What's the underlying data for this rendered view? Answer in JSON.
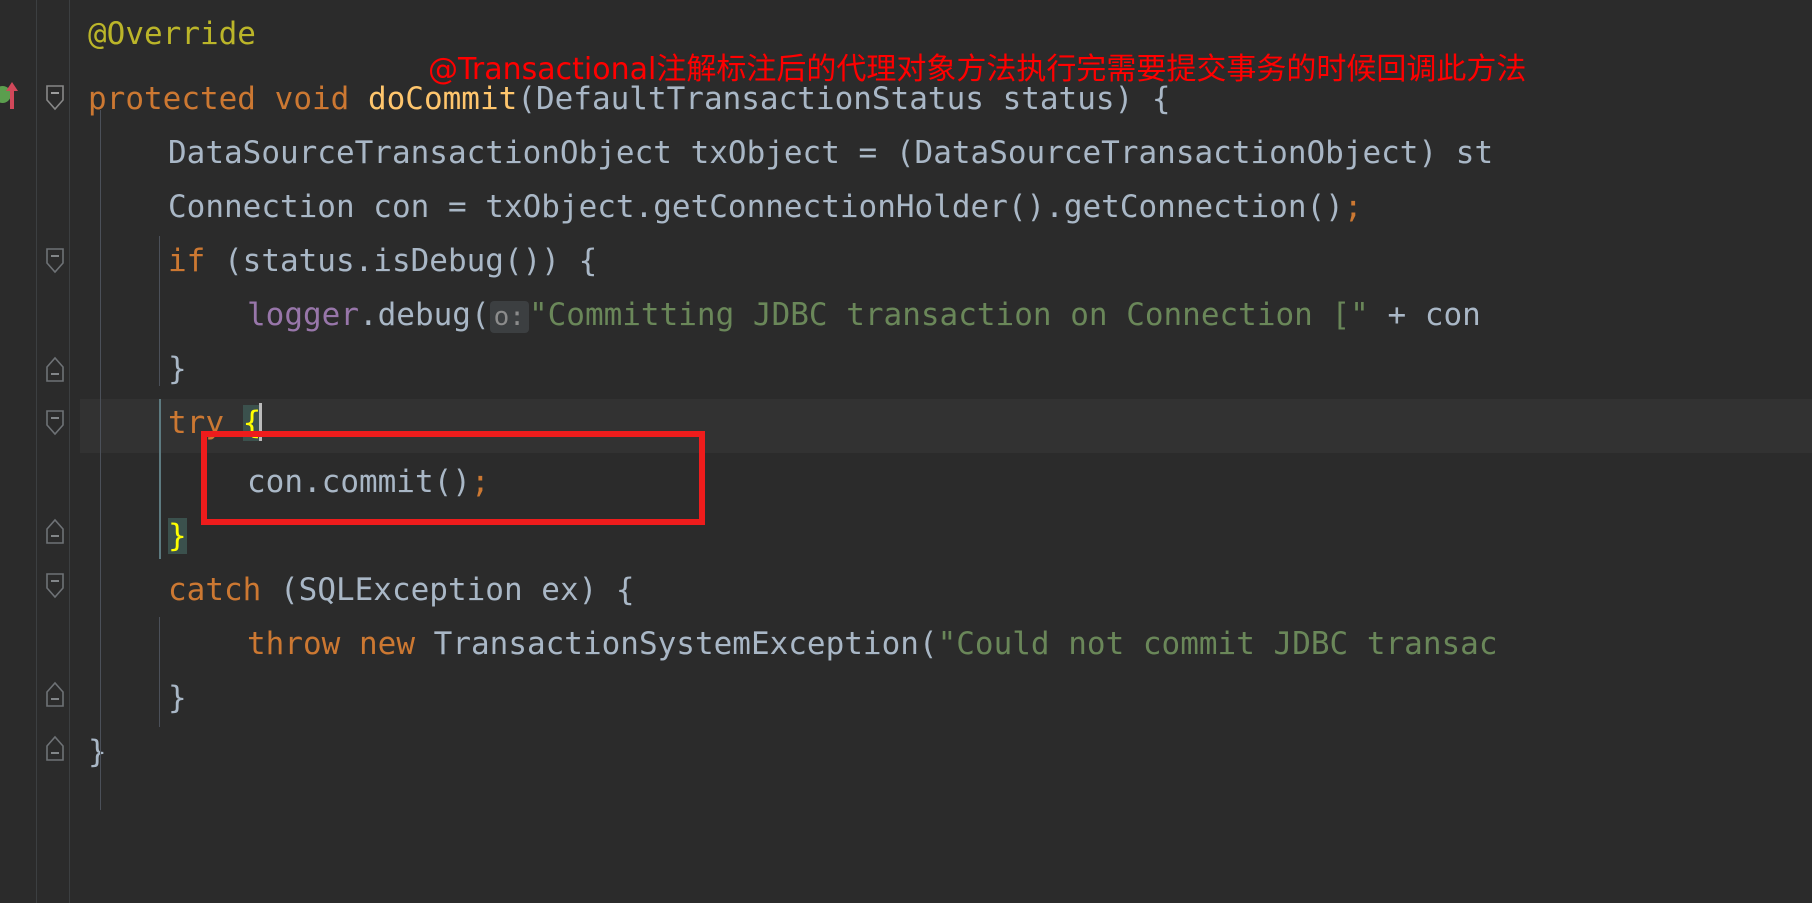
{
  "editor": {
    "theme_background": "#2b2b2b",
    "current_line_background": "#323232",
    "language": "Java"
  },
  "annotation": {
    "note_text": "@Transactional注解标注后的代理对象方法执行完需要提交事务的时候回调此方法",
    "note_color": "#ff0000",
    "box_color": "#ee1c1c",
    "box_target": "con.commit();"
  },
  "gutter": {
    "method_marker": "green-circle-run-marker",
    "override_marker": "red-up-arrow-override-icon",
    "fold_collapse_label": "−",
    "markers": [
      {
        "type": "method-run-dot",
        "line": 2
      },
      {
        "type": "override-arrow",
        "line": 2
      },
      {
        "type": "fold-minus",
        "line": 2
      },
      {
        "type": "fold-minus",
        "line": 5
      },
      {
        "type": "fold-end",
        "line": 7
      },
      {
        "type": "fold-minus",
        "line": 8
      },
      {
        "type": "fold-end",
        "line": 10
      },
      {
        "type": "fold-minus",
        "line": 11
      },
      {
        "type": "fold-end",
        "line": 13
      },
      {
        "type": "fold-end",
        "line": 14
      }
    ]
  },
  "code": {
    "lines": [
      {
        "n": 1,
        "indent": 1,
        "text": "@Override",
        "tokens": [
          {
            "t": "@Override",
            "c": "anno"
          }
        ]
      },
      {
        "n": 2,
        "indent": 1,
        "text": "protected void doCommit(DefaultTransactionStatus status) {",
        "tokens": [
          {
            "t": "protected",
            "c": "kw"
          },
          {
            "t": " ",
            "c": "punct"
          },
          {
            "t": "void",
            "c": "kw"
          },
          {
            "t": " ",
            "c": "punct"
          },
          {
            "t": "doCommit",
            "c": "mname"
          },
          {
            "t": "(",
            "c": "punct"
          },
          {
            "t": "DefaultTransactionStatus",
            "c": "type"
          },
          {
            "t": " status",
            "c": "type"
          },
          {
            "t": ") {",
            "c": "punct"
          }
        ]
      },
      {
        "n": 3,
        "indent": 2,
        "text": "DataSourceTransactionObject txObject = (DataSourceTransactionObject) st",
        "truncated": true,
        "tokens": [
          {
            "t": "DataSourceTransactionObject txObject = (DataSourceTransactionObject) st",
            "c": "type"
          }
        ]
      },
      {
        "n": 4,
        "indent": 2,
        "text": "Connection con = txObject.getConnectionHolder().getConnection();",
        "tokens": [
          {
            "t": "Connection con = txObject.getConnectionHolder().getConnection()",
            "c": "type"
          },
          {
            "t": ";",
            "c": "semi"
          }
        ]
      },
      {
        "n": 5,
        "indent": 2,
        "text": "if (status.isDebug()) {",
        "tokens": [
          {
            "t": "if",
            "c": "kw"
          },
          {
            "t": " (status.isDebug()) {",
            "c": "type"
          }
        ]
      },
      {
        "n": 6,
        "indent": 3,
        "text": "logger.debug( o: \"Committing JDBC transaction on Connection [\" + con",
        "truncated": true,
        "hint": "o:",
        "tokens": [
          {
            "t": "logger",
            "c": "field"
          },
          {
            "t": ".debug(",
            "c": "type"
          },
          {
            "t": "o:",
            "c": "hint"
          },
          {
            "t": "\"Committing JDBC transaction on Connection [\"",
            "c": "str"
          },
          {
            "t": " + con",
            "c": "type"
          }
        ]
      },
      {
        "n": 7,
        "indent": 2,
        "text": "}",
        "tokens": [
          {
            "t": "}",
            "c": "punct"
          }
        ]
      },
      {
        "n": 8,
        "indent": 2,
        "text": "try {",
        "current": true,
        "caret_after": "{",
        "tokens": [
          {
            "t": "try",
            "c": "kw"
          },
          {
            "t": " ",
            "c": "punct"
          },
          {
            "t": "{",
            "c": "brace-hl"
          }
        ]
      },
      {
        "n": 9,
        "indent": 3,
        "text": "con.commit();",
        "highlighted": true,
        "tokens": [
          {
            "t": "con.commit()",
            "c": "type"
          },
          {
            "t": ";",
            "c": "semi"
          }
        ]
      },
      {
        "n": 10,
        "indent": 2,
        "text": "}",
        "tokens": [
          {
            "t": "}",
            "c": "brace-hl"
          }
        ]
      },
      {
        "n": 11,
        "indent": 2,
        "text": "catch (SQLException ex) {",
        "tokens": [
          {
            "t": "catch",
            "c": "kw"
          },
          {
            "t": " (SQLException ex) {",
            "c": "type"
          }
        ]
      },
      {
        "n": 12,
        "indent": 3,
        "text": "throw new TransactionSystemException(\"Could not commit JDBC transac",
        "truncated": true,
        "tokens": [
          {
            "t": "throw",
            "c": "kw"
          },
          {
            "t": " ",
            "c": "punct"
          },
          {
            "t": "new",
            "c": "kw"
          },
          {
            "t": " TransactionSystemException(",
            "c": "type"
          },
          {
            "t": "\"Could not commit JDBC transac",
            "c": "str"
          }
        ]
      },
      {
        "n": 13,
        "indent": 2,
        "text": "}",
        "tokens": [
          {
            "t": "}",
            "c": "punct"
          }
        ]
      },
      {
        "n": 14,
        "indent": 1,
        "text": "}",
        "tokens": [
          {
            "t": "}",
            "c": "punct"
          }
        ]
      }
    ]
  }
}
